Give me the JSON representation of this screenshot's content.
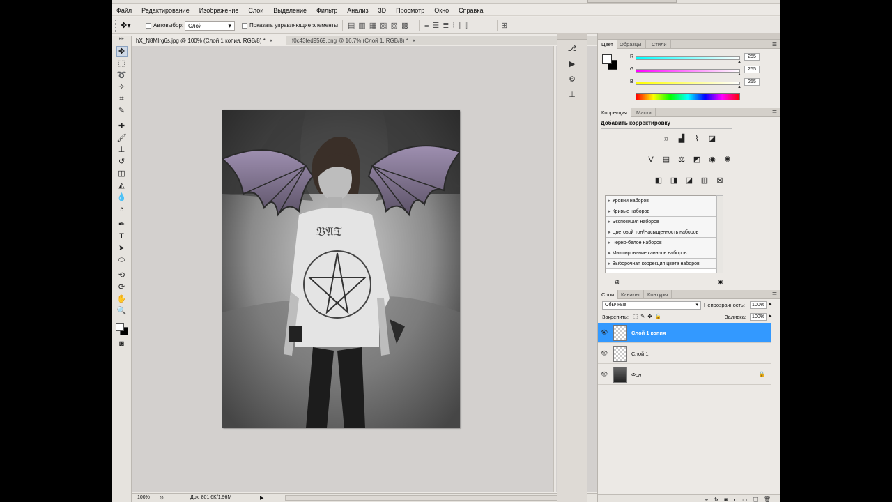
{
  "menu": [
    "Файл",
    "Редактирование",
    "Изображение",
    "Слои",
    "Выделение",
    "Фильтр",
    "Анализ",
    "3D",
    "Просмотр",
    "Окно",
    "Справка"
  ],
  "options": {
    "autoselect_label": "Автовыбор:",
    "autoselect_value": "Слой",
    "show_controls_label": "Показать управляющие элементы"
  },
  "tabs": [
    {
      "label": "hX_N8MIrg6s.jpg @ 100% (Слой 1 копия, RGB/8) *",
      "close": "×"
    },
    {
      "label": "f0c43fed9569.png @ 16,7% (Слой 1, RGB/8) *",
      "close": "×"
    }
  ],
  "status": {
    "zoom": "100%",
    "doc": "Док: 801,6K/1,96M"
  },
  "color_panel": {
    "tabs": [
      "Цвет",
      "Образцы",
      "Стили"
    ],
    "channels": [
      {
        "name": "R",
        "value": "255",
        "gradient": "linear-gradient(to right,#00ffff,#ffffff)"
      },
      {
        "name": "G",
        "value": "255",
        "gradient": "linear-gradient(to right,#ff00ff,#ffffff)"
      },
      {
        "name": "B",
        "value": "255",
        "gradient": "linear-gradient(to right,#ffff00,#ffffff)"
      }
    ]
  },
  "adjust_panel": {
    "tabs": [
      "Коррекция",
      "Маски"
    ],
    "title": "Добавить корректировку",
    "presets": [
      "Уровни наборов",
      "Кривые наборов",
      "Экспозиция наборов",
      "Цветовой тон/Насыщенность наборов",
      "Черно-белое наборов",
      "Микширование каналов наборов",
      "Выборочная коррекция цвета наборов"
    ]
  },
  "layers_panel": {
    "tabs": [
      "Слои",
      "Каналы",
      "Контуры"
    ],
    "blend_mode": "Обычные",
    "opacity_label": "Непрозрачность:",
    "opacity_value": "100%",
    "lock_label": "Закрепить:",
    "fill_label": "Заливка:",
    "fill_value": "100%",
    "layers": [
      {
        "name": "Слой 1 копия",
        "selected": true
      },
      {
        "name": "Слой 1",
        "selected": false
      },
      {
        "name": "Фон",
        "selected": false,
        "locked": true
      }
    ]
  },
  "accent_color": "#3399ff"
}
